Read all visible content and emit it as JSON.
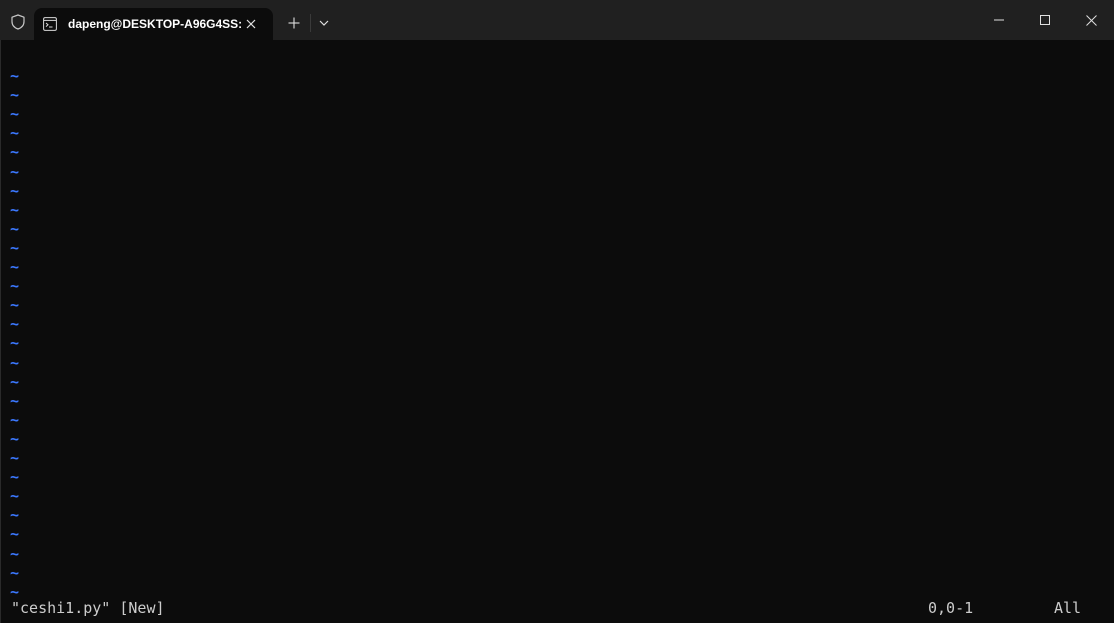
{
  "window": {
    "tab_title": "dapeng@DESKTOP-A96G4SS:",
    "icons": {
      "shield": "shield-icon",
      "tab": "terminal-icon",
      "tab_close": "close-icon",
      "new_tab": "plus-icon",
      "dropdown": "chevron-down-icon",
      "minimize": "minimize-icon",
      "maximize": "maximize-icon",
      "close": "close-icon"
    }
  },
  "editor": {
    "empty_line_marker": "~",
    "empty_line_count": 28,
    "status_file": "\"ceshi1.py\" [New]",
    "status_position": "0,0-1",
    "status_scroll": "All"
  },
  "colors": {
    "background": "#0c0c0c",
    "titlebar": "#202020",
    "tilde": "#3b78ff",
    "text": "#cccccc"
  }
}
